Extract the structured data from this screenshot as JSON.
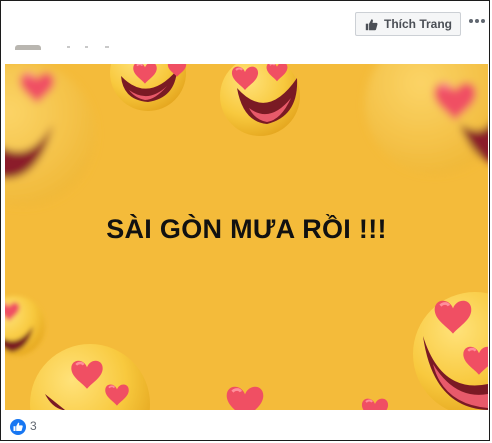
{
  "header": {
    "like_page_label": "Thích Trang",
    "more_label": "•••"
  },
  "post": {
    "image_text": "SÀI GÒN MƯA RỒI !!!",
    "colors": {
      "background": "#f4bb3a",
      "emoji_face": "#f7c53d",
      "heart": "#f04f63",
      "mouth": "#7a1a24"
    }
  },
  "footer": {
    "reaction_icon": "like-icon",
    "reaction_count": "3"
  }
}
